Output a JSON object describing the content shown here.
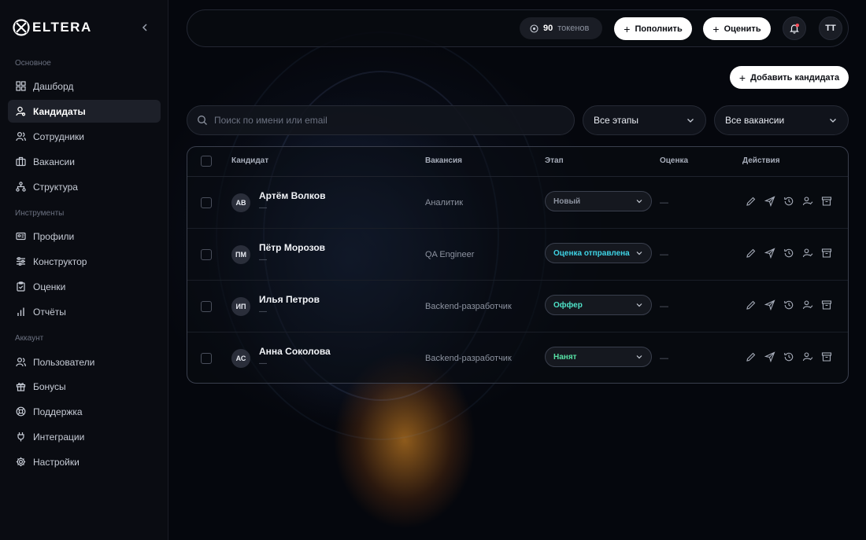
{
  "brand": {
    "name": "ELTERA"
  },
  "sidebar": {
    "sections": [
      {
        "title": "Основное",
        "items": [
          {
            "label": "Дашборд",
            "icon": "grid-icon"
          },
          {
            "label": "Кандидаты",
            "icon": "user-search-icon",
            "active": true
          },
          {
            "label": "Сотрудники",
            "icon": "users-icon"
          },
          {
            "label": "Вакансии",
            "icon": "briefcase-icon"
          },
          {
            "label": "Структура",
            "icon": "hierarchy-icon"
          }
        ]
      },
      {
        "title": "Инструменты",
        "items": [
          {
            "label": "Профили",
            "icon": "id-card-icon"
          },
          {
            "label": "Конструктор",
            "icon": "sliders-icon"
          },
          {
            "label": "Оценки",
            "icon": "clipboard-check-icon"
          },
          {
            "label": "Отчёты",
            "icon": "bar-chart-icon"
          }
        ]
      },
      {
        "title": "Аккаунт",
        "items": [
          {
            "label": "Пользователи",
            "icon": "users-icon"
          },
          {
            "label": "Бонусы",
            "icon": "gift-icon"
          },
          {
            "label": "Поддержка",
            "icon": "lifebuoy-icon"
          },
          {
            "label": "Интеграции",
            "icon": "plug-icon"
          },
          {
            "label": "Настройки",
            "icon": "gear-icon"
          }
        ]
      }
    ]
  },
  "header": {
    "tokens_value": "90",
    "tokens_label": "токенов",
    "topup_label": "Пополнить",
    "evaluate_label": "Оценить",
    "avatar_initials": "TT"
  },
  "toolbar": {
    "add_candidate_label": "Добавить кандидата"
  },
  "filters": {
    "search_placeholder": "Поиск по имени или email",
    "stage_select": "Все этапы",
    "vacancy_select": "Все вакансии"
  },
  "table": {
    "columns": [
      "Кандидат",
      "Вакансия",
      "Этап",
      "Оценка",
      "Действия"
    ],
    "rows": [
      {
        "initials": "АВ",
        "name": "Артём Волков",
        "sub": "—",
        "vacancy": "Аналитик",
        "stage": "Новый",
        "stage_color": "#8d93a0",
        "score": "—"
      },
      {
        "initials": "ПМ",
        "name": "Пётр Морозов",
        "sub": "—",
        "vacancy": "QA Engineer",
        "stage": "Оценка отправлена",
        "stage_color": "#3fd4e6",
        "score": "—"
      },
      {
        "initials": "ИП",
        "name": "Илья Петров",
        "sub": "—",
        "vacancy": "Backend-разработчик",
        "stage": "Оффер",
        "stage_color": "#4fe2c8",
        "score": "—"
      },
      {
        "initials": "АС",
        "name": "Анна Соколова",
        "sub": "—",
        "vacancy": "Backend-разработчик",
        "stage": "Нанят",
        "stage_color": "#56e0a4",
        "score": "—"
      }
    ]
  }
}
